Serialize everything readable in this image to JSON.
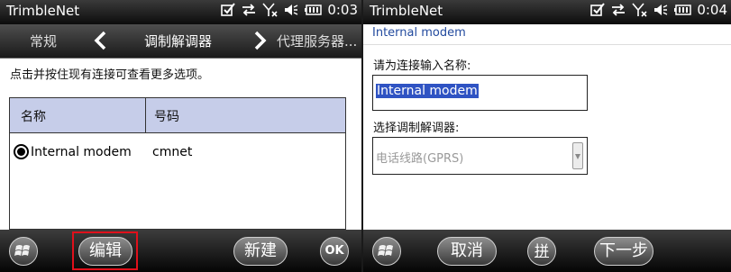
{
  "left_screen": {
    "status": {
      "app_title": "TrimbleNet",
      "time": "0:03"
    },
    "tabs": {
      "prev": "常规",
      "current": "调制解调器",
      "next": "代理服务器..."
    },
    "hint": "点击并按住现有连接可查看更多选项。",
    "table": {
      "headers": [
        "名称",
        "号码"
      ],
      "rows": [
        {
          "name": "Internal modem",
          "number": "cmnet",
          "selected": true
        }
      ]
    },
    "toolbar": {
      "edit_label": "编辑",
      "new_label": "新建",
      "ok_label": "OK"
    }
  },
  "right_screen": {
    "status": {
      "app_title": "TrimbleNet",
      "time": "0:04"
    },
    "page_title": "Internal modem",
    "name_label": "请为连接输入名称:",
    "name_value": "Internal modem",
    "modem_label": "选择调制解调器:",
    "modem_value": "电话线路(GPRS)",
    "toolbar": {
      "cancel_label": "取消",
      "ime_label": "拼",
      "next_label": "下一步"
    }
  },
  "colors": {
    "highlight": "#e0101b",
    "header_bg": "#c6cde9",
    "selection": "#2f53c3",
    "title_blue": "#224a9e"
  },
  "icons": [
    "windows-start-icon",
    "checkbox-icon",
    "sync-icon",
    "signal-off-icon",
    "volume-icon",
    "battery-icon",
    "chevron-left-icon",
    "chevron-right-icon",
    "dropdown-arrow-icon"
  ]
}
